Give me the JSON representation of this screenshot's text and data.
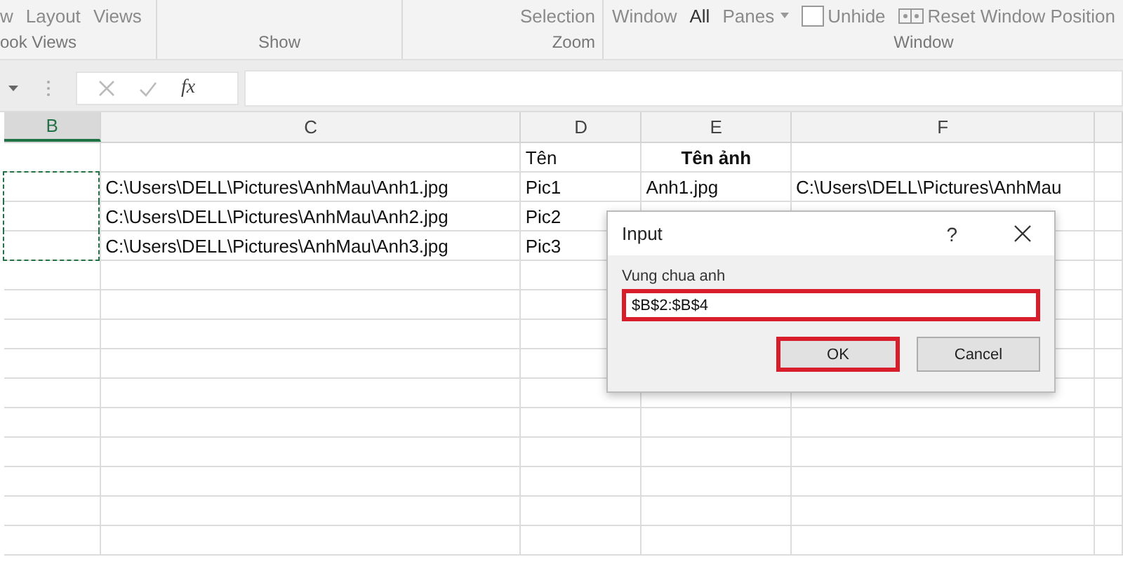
{
  "ribbon": {
    "groups": [
      {
        "label": "ook Views",
        "items": [
          {
            "text": "w",
            "kind": "text"
          },
          {
            "text": "Layout",
            "kind": "text"
          },
          {
            "text": "Views",
            "kind": "text"
          }
        ]
      },
      {
        "label": "Show"
      },
      {
        "label": "Zoom",
        "items": [
          {
            "text": "Selection",
            "kind": "text"
          }
        ]
      },
      {
        "label": "Window",
        "items": [
          {
            "text": "Window",
            "kind": "text"
          },
          {
            "text": "All",
            "kind": "strong"
          },
          {
            "text": "Panes",
            "kind": "dropdown"
          },
          {
            "text": "Unhide",
            "kind": "checkbox",
            "checked": false
          },
          {
            "text": "Reset Window Position",
            "kind": "iconed"
          }
        ]
      }
    ]
  },
  "formula_bar": {
    "function_label": "fx"
  },
  "columns": [
    {
      "label": "B",
      "selected": true
    },
    {
      "label": "C",
      "selected": false
    },
    {
      "label": "D",
      "selected": false
    },
    {
      "label": "E",
      "selected": false
    },
    {
      "label": "F",
      "selected": false
    }
  ],
  "rows": [
    {
      "in_copy_range": false,
      "d": {
        "text": "Tên",
        "bold": false
      },
      "e": {
        "text": "Tên ảnh",
        "bold": true
      }
    },
    {
      "in_copy_range": true,
      "c": {
        "text": "C:\\Users\\DELL\\Pictures\\AnhMau\\Anh1.jpg",
        "bold": false
      },
      "d": {
        "text": "Pic1",
        "bold": false
      },
      "e": {
        "text": "Anh1.jpg",
        "bold": false
      },
      "f": {
        "text": "C:\\Users\\DELL\\Pictures\\AnhMau",
        "bold": false
      }
    },
    {
      "in_copy_range": true,
      "c": {
        "text": "C:\\Users\\DELL\\Pictures\\AnhMau\\Anh2.jpg",
        "bold": false
      },
      "d": {
        "text": "Pic2",
        "bold": false
      }
    },
    {
      "in_copy_range": true,
      "c": {
        "text": "C:\\Users\\DELL\\Pictures\\AnhMau\\Anh3.jpg",
        "bold": false
      },
      "d": {
        "text": "Pic3",
        "bold": false
      }
    }
  ],
  "dialog": {
    "title": "Input",
    "help": "?",
    "prompt": "Vung chua anh",
    "value": "$B$2:$B$4",
    "buttons": [
      {
        "label": "OK",
        "default": true
      },
      {
        "label": "Cancel",
        "default": false
      }
    ]
  }
}
